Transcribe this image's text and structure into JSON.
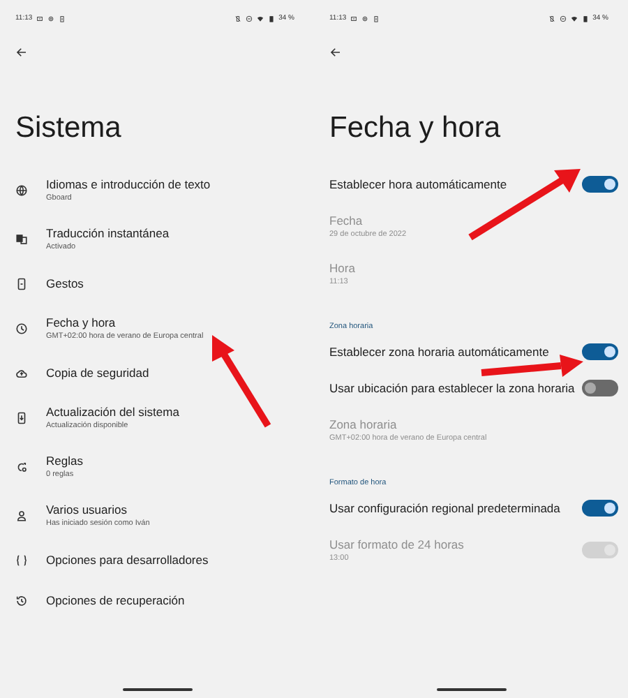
{
  "screens": [
    {
      "status_bar": {
        "time": "11:13",
        "battery": "34 %"
      },
      "title": "Sistema",
      "items": [
        {
          "kind": "nav",
          "title": "Idiomas e introducción de texto",
          "subtitle": "Gboard"
        },
        {
          "kind": "nav",
          "title": "Traducción instantánea",
          "subtitle": "Activado"
        },
        {
          "kind": "nav",
          "title": "Gestos"
        },
        {
          "kind": "nav",
          "title": "Fecha y hora",
          "subtitle": "GMT+02:00 hora de verano de Europa central"
        },
        {
          "kind": "nav",
          "title": "Copia de seguridad"
        },
        {
          "kind": "nav",
          "title": "Actualización del sistema",
          "subtitle": "Actualización disponible"
        },
        {
          "kind": "nav",
          "title": "Reglas",
          "subtitle": "0 reglas"
        },
        {
          "kind": "nav",
          "title": "Varios usuarios",
          "subtitle": "Has iniciado sesión como Iván"
        },
        {
          "kind": "nav",
          "title": "Opciones para desarrolladores"
        },
        {
          "kind": "nav",
          "title": "Opciones de recuperación"
        }
      ]
    },
    {
      "status_bar": {
        "time": "11:13",
        "battery": "34 %"
      },
      "title": "Fecha y hora",
      "items": [
        {
          "kind": "switch",
          "title": "Establecer hora automáticamente",
          "on": true,
          "disabled": false
        },
        {
          "kind": "info",
          "title": "Fecha",
          "subtitle": "29 de octubre de 2022",
          "disabled": true
        },
        {
          "kind": "info",
          "title": "Hora",
          "subtitle": "11:13",
          "disabled": true
        },
        {
          "kind": "header",
          "title": "Zona horaria"
        },
        {
          "kind": "switch",
          "title": "Establecer zona horaria automáticamente",
          "on": true,
          "disabled": false
        },
        {
          "kind": "switch",
          "title": "Usar ubicación para establecer la zona horaria",
          "on": false,
          "disabled": false
        },
        {
          "kind": "info",
          "title": "Zona horaria",
          "subtitle": "GMT+02:00 hora de verano de Europa central",
          "disabled": true
        },
        {
          "kind": "header",
          "title": "Formato de hora"
        },
        {
          "kind": "switch",
          "title": "Usar configuración regional predeterminada",
          "on": true,
          "disabled": false
        },
        {
          "kind": "switch",
          "title": "Usar formato de 24 horas",
          "subtitle": "13:00",
          "on": true,
          "disabled": true
        }
      ]
    }
  ]
}
